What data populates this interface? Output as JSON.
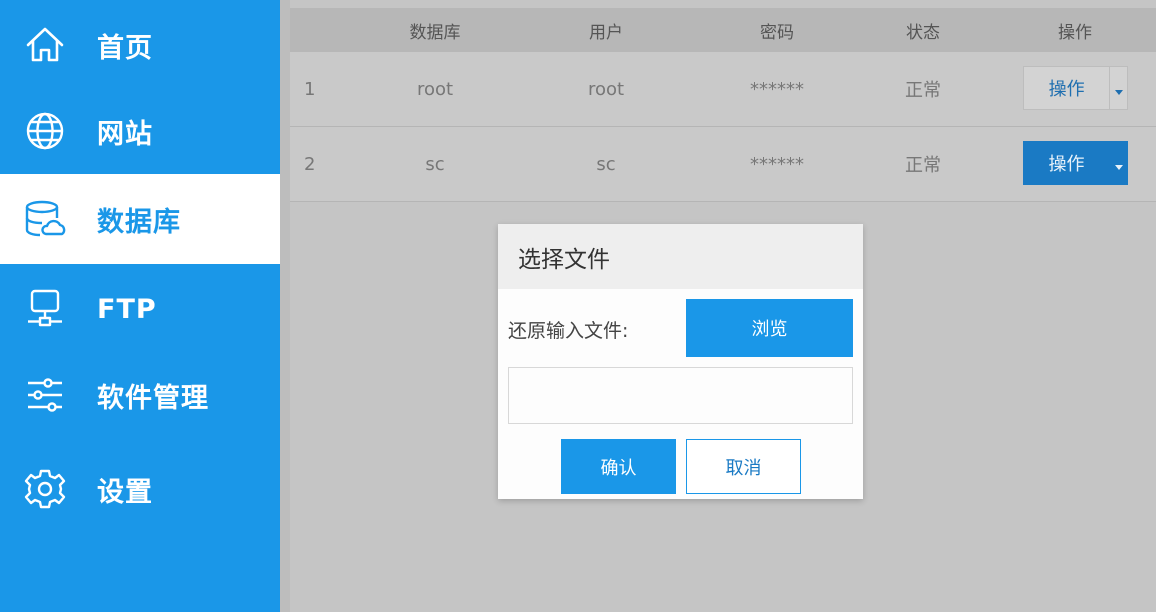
{
  "sidebar": {
    "accent_color": "#1a97e8",
    "items": [
      {
        "label": "首页",
        "icon": "home-icon"
      },
      {
        "label": "网站",
        "icon": "globe-icon"
      },
      {
        "label": "数据库",
        "icon": "database-icon",
        "active": true
      },
      {
        "label": "FTP",
        "icon": "ftp-icon"
      },
      {
        "label": "软件管理",
        "icon": "sliders-icon"
      },
      {
        "label": "设置",
        "icon": "gear-icon"
      }
    ]
  },
  "table": {
    "headers": [
      "",
      "数据库",
      "用户",
      "密码",
      "状态",
      "操作"
    ],
    "rows": [
      {
        "index": "1",
        "database": "root",
        "user": "root",
        "password": "******",
        "status": "正常",
        "action": "操作"
      },
      {
        "index": "2",
        "database": "sc",
        "user": "sc",
        "password": "******",
        "status": "正常",
        "action": "操作"
      }
    ]
  },
  "dialog": {
    "title": "选择文件",
    "restore_label": "还原输入文件:",
    "browse_label": "浏览",
    "confirm_label": "确认",
    "cancel_label": "取消"
  }
}
